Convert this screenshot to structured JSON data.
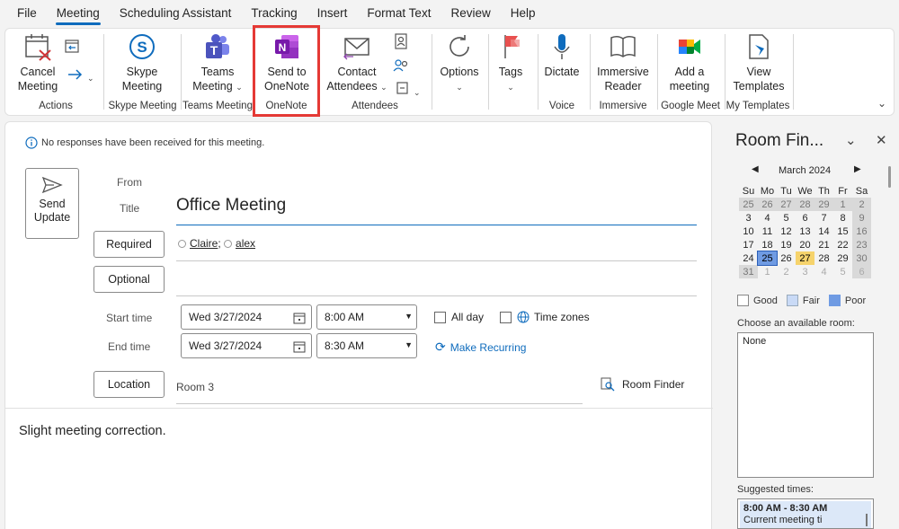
{
  "menu": [
    "File",
    "Meeting",
    "Scheduling Assistant",
    "Tracking",
    "Insert",
    "Format Text",
    "Review",
    "Help"
  ],
  "ribbon": {
    "cancel_meeting": "Cancel\nMeeting",
    "cancel_l1": "Cancel",
    "cancel_l2": "Meeting",
    "group_actions": "Actions",
    "skype_l1": "Skype",
    "skype_l2": "Meeting",
    "group_skype": "Skype Meeting",
    "teams_l1": "Teams",
    "teams_l2": "Meeting",
    "group_teams": "Teams Meeting",
    "onenote_l1": "Send to",
    "onenote_l2": "OneNote",
    "group_onenote": "OneNote",
    "contact_l1": "Contact",
    "contact_l2": "Attendees",
    "group_attendees": "Attendees",
    "options": "Options",
    "tags": "Tags",
    "dictate": "Dictate",
    "group_voice": "Voice",
    "immersive_l1": "Immersive",
    "immersive_l2": "Reader",
    "group_immersive": "Immersive",
    "gmeet_l1": "Add a",
    "gmeet_l2": "meeting",
    "group_gmeet": "Google Meet",
    "templates_l1": "View",
    "templates_l2": "Templates",
    "group_templates": "My Templates"
  },
  "form": {
    "info": "No responses have been received for this meeting.",
    "send_l1": "Send",
    "send_l2": "Update",
    "from_label": "From",
    "title_label": "Title",
    "title_value": "Office Meeting",
    "required_btn": "Required",
    "attendee1": "Claire",
    "attendee2": "alex",
    "optional_btn": "Optional",
    "start_label": "Start time",
    "end_label": "End time",
    "start_date": "Wed 3/27/2024",
    "start_time": "8:00 AM",
    "end_date": "Wed 3/27/2024",
    "end_time": "8:30 AM",
    "all_day": "All day",
    "time_zones": "Time zones",
    "make_recurring": "Make Recurring",
    "location_btn": "Location",
    "location_value": "Room 3",
    "room_finder": "Room Finder",
    "body_text": "Slight meeting correction."
  },
  "room_finder": {
    "title": "Room Fin...",
    "month": "March 2024",
    "weekdays": [
      "Su",
      "Mo",
      "Tu",
      "We",
      "Th",
      "Fr",
      "Sa"
    ],
    "legend_good": "Good",
    "legend_fair": "Fair",
    "legend_poor": "Poor",
    "choose_label": "Choose an available room:",
    "room_option": "None",
    "suggested_label": "Suggested times:",
    "suggested_time": "8:00 AM - 8:30 AM",
    "suggested_note": "Current meeting ti"
  },
  "colors": {
    "accent": "#0f6cbd",
    "highlight_border": "#e53935",
    "selected_day": "#6f9be3",
    "today": "#f6d36c"
  }
}
